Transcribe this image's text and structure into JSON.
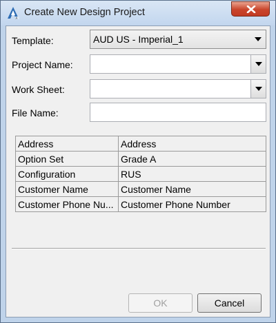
{
  "window": {
    "title": "Create New Design Project",
    "icon": "autodesk-a-icon",
    "close_icon": "close-icon"
  },
  "form": {
    "template": {
      "label": "Template:",
      "value": "AUD US - Imperial_1"
    },
    "project_name": {
      "label": "Project Name:",
      "value": ""
    },
    "work_sheet": {
      "label": "Work Sheet:",
      "value": ""
    },
    "file_name": {
      "label": "File Name:",
      "value": ""
    }
  },
  "properties": {
    "rows": [
      {
        "name": "Address",
        "value": "Address"
      },
      {
        "name": "Option Set",
        "value": "Grade A"
      },
      {
        "name": "Configuration",
        "value": "RUS"
      },
      {
        "name": "Customer Name",
        "value": "Customer Name"
      },
      {
        "name": "Customer Phone Nu...",
        "value": "Customer Phone Number"
      }
    ]
  },
  "buttons": {
    "ok": {
      "label": "OK",
      "enabled": false
    },
    "cancel": {
      "label": "Cancel",
      "enabled": true
    }
  },
  "colors": {
    "close_button": "#c9452c",
    "window_frame": "#bfd3ea",
    "client_bg": "#f0f0f0"
  }
}
